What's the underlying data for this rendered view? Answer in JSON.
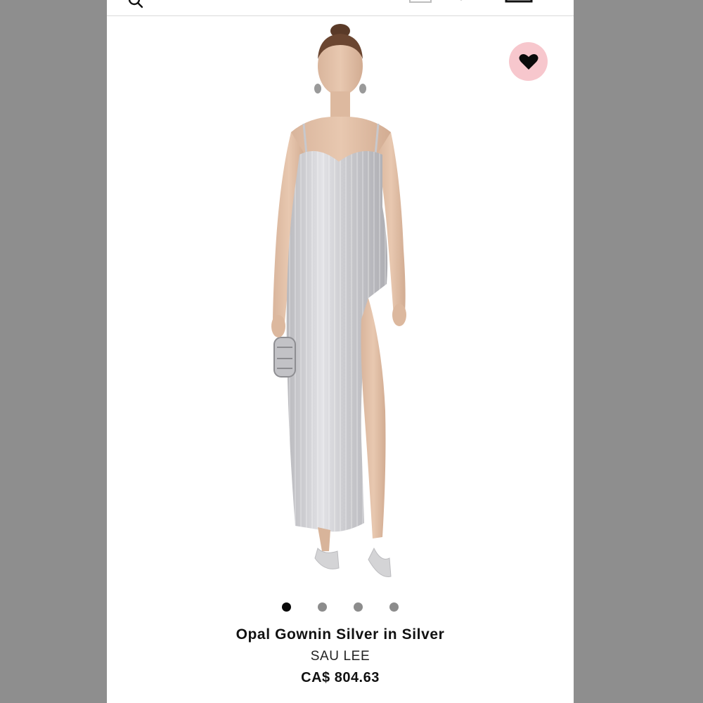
{
  "header": {
    "icons": [
      "search-icon",
      "account-icon",
      "help-icon",
      "bag-icon"
    ]
  },
  "product": {
    "name": "Opal Gownin Silver in Silver",
    "brand": "SAU LEE",
    "price": "CA$ 804.63",
    "image_description_icon": "product-photo"
  },
  "wishlist": {
    "icon": "heart-icon",
    "background_color": "#f7c7cd"
  },
  "carousel": {
    "total_images": 4,
    "active_index": 0
  },
  "colors": {
    "page_background": "#ffffff",
    "backdrop": "#8e8e8e",
    "dot_active": "#0a0a0a",
    "dot_inactive": "#8c8c8c"
  }
}
